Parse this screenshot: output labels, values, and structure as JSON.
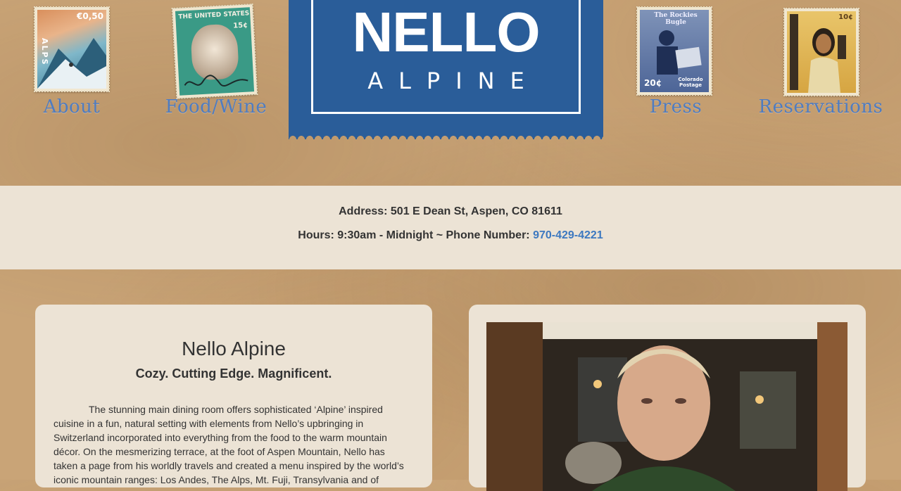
{
  "nav": {
    "about": "About",
    "food_wine": "Food/Wine",
    "press": "Press",
    "reservations": "Reservations"
  },
  "stamps": {
    "about_value": "€0,50",
    "about_word": "ALPS",
    "food_top": "THE UNITED STATES",
    "food_value": "15¢",
    "press_top": "The Rockies Bugle",
    "press_value": "20¢",
    "press_sub": "Colorado Postage",
    "res_value": "10¢"
  },
  "logo": {
    "title": "NELLO",
    "subtitle": "ALPINE"
  },
  "info": {
    "address": "Address: 501 E Dean St, Aspen, CO 81611",
    "hours": "Hours: 9:30am - Midnight ~ Phone Number: ",
    "phone": "970-429-4221"
  },
  "about_card": {
    "title": "Nello Alpine",
    "tagline": "Cozy. Cutting Edge. Magnificent.",
    "body": "The stunning main dining room offers sophisticated ‘Alpine’ inspired cuisine in a fun, natural setting with elements from Nello’s upbringing in Switzerland incorporated into everything from the food to the warm mountain décor. On the mesmerizing terrace, at the foot of Aspen Mountain, Nello has taken a page from his worldly travels and created a menu inspired by the world’s iconic mountain ranges: Los Andes, The Alps, Mt. Fuji, Transylvania and of"
  },
  "colors": {
    "background": "#c9a477",
    "logo_blue": "#2a5d99",
    "nav_blue": "#4f7cc0",
    "band": "#ece3d5",
    "link": "#3c78c0"
  }
}
